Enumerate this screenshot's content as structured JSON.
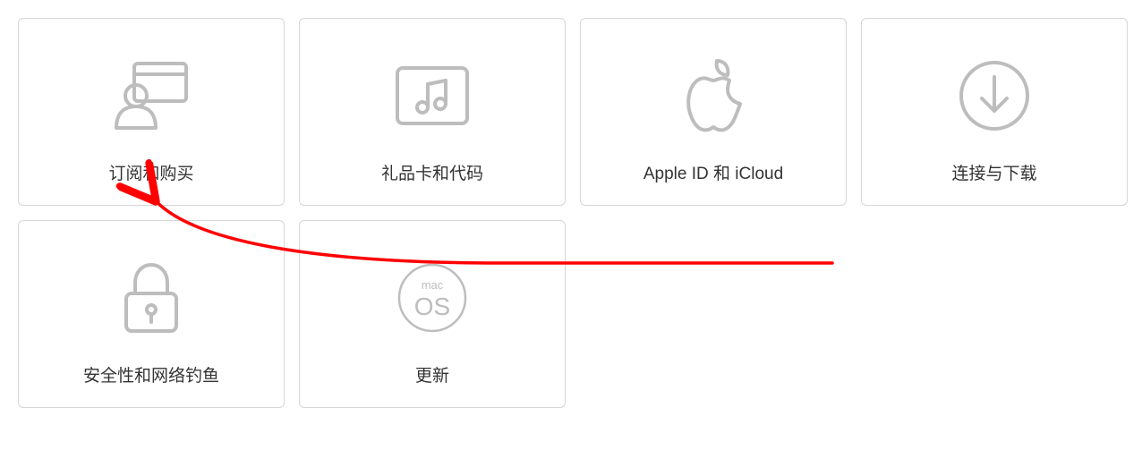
{
  "tiles": [
    {
      "label": "订阅和购买",
      "icon": "person-card-icon"
    },
    {
      "label": "礼品卡和代码",
      "icon": "giftcard-music-icon"
    },
    {
      "label": "Apple ID 和 iCloud",
      "icon": "apple-icon"
    },
    {
      "label": "连接与下载",
      "icon": "download-circle-icon"
    },
    {
      "label": "安全性和网络钓鱼",
      "icon": "lock-icon"
    },
    {
      "label": "更新",
      "icon": "macos-badge-icon"
    }
  ],
  "annotation": {
    "color": "#ff0000"
  }
}
